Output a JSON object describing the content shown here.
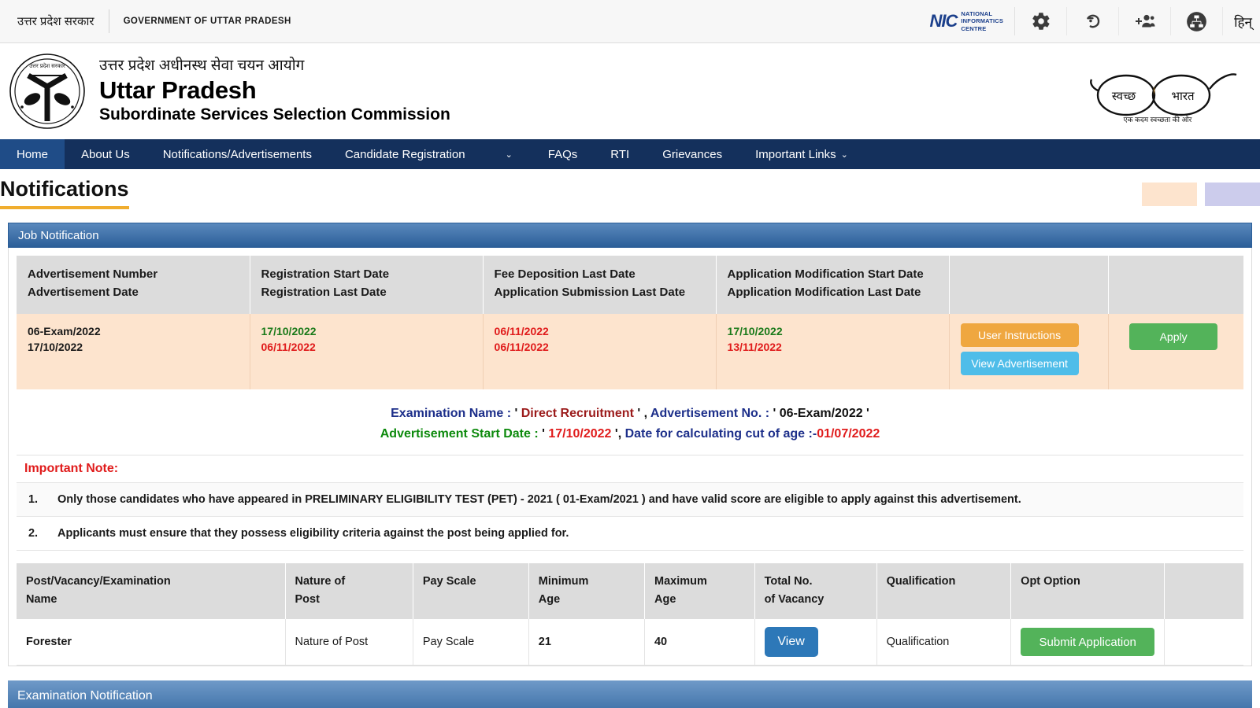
{
  "gov_strip": {
    "hindi": "उत्तर प्रदेश सरकार",
    "english": "GOVERNMENT OF UTTAR PRADESH",
    "nic_mark": "NIC",
    "nic_line1": "NATIONAL",
    "nic_line2": "INFORMATICS",
    "nic_line3": "CENTRE",
    "icons": [
      {
        "name": "gear-icon",
        "label": "Settings"
      },
      {
        "name": "undo-icon",
        "label": "Reset"
      },
      {
        "name": "add-user-icon",
        "label": "Add User"
      },
      {
        "name": "sitemap-icon",
        "label": "Site Map"
      }
    ],
    "language_toggle": "हिन्"
  },
  "masthead": {
    "org_hindi": "उत्तर प्रदेश अधीनस्थ सेवा चयन आयोग",
    "org_name": "Uttar Pradesh",
    "org_sub": "Subordinate Services Selection Commission",
    "swachh_hindi_left": "स्वच्छ",
    "swachh_hindi_right": "भारत",
    "swachh_tagline": "एक कदम स्वच्छता की ओर"
  },
  "nav": {
    "items": [
      {
        "label": "Home",
        "active": true,
        "caret": false
      },
      {
        "label": "About Us",
        "active": false,
        "caret": false
      },
      {
        "label": "Notifications/Advertisements",
        "active": false,
        "caret": false
      },
      {
        "label": "Candidate Registration",
        "active": false,
        "caret": false
      },
      {
        "label": "",
        "active": false,
        "caret": true
      },
      {
        "label": "FAQs",
        "active": false,
        "caret": false
      },
      {
        "label": "RTI",
        "active": false,
        "caret": false
      },
      {
        "label": "Grievances",
        "active": false,
        "caret": false
      },
      {
        "label": "Important Links",
        "active": false,
        "caret": true
      }
    ],
    "caret_glyph": "⌄"
  },
  "page": {
    "title": "Notifications",
    "title_underline_color": "#f0ad2e",
    "legend": [
      {
        "name": "legend-peach",
        "color": "#fde4ce"
      },
      {
        "name": "legend-lavender",
        "color": "#ccccec"
      }
    ]
  },
  "job_panel": {
    "heading": "Job Notification",
    "columns": [
      {
        "line1": "Advertisement Number",
        "line2": "Advertisement Date"
      },
      {
        "line1": "Registration Start Date",
        "line2": "Registration Last Date"
      },
      {
        "line1": "Fee Deposition Last Date",
        "line2": "Application Submission Last Date"
      },
      {
        "line1": "Application Modification Start Date",
        "line2": "Application Modification Last Date"
      },
      {
        "line1": "",
        "line2": ""
      },
      {
        "line1": "",
        "line2": ""
      }
    ],
    "row": {
      "advertisement_number": "06-Exam/2022",
      "advertisement_date": "17/10/2022",
      "registration_start_date": "17/10/2022",
      "registration_last_date": "06/11/2022",
      "fee_deposition_last_date": "06/11/2022",
      "application_submission_last_date": "06/11/2022",
      "application_modification_start_date": "17/10/2022",
      "application_modification_last_date": "13/11/2022",
      "btn_user_instructions": "User Instructions",
      "btn_view_advertisement": "View Advertisement",
      "btn_apply": "Apply"
    }
  },
  "exam_info": {
    "line1_label_a": "Examination Name : ",
    "line1_quote_open_a": "' ",
    "line1_value_a": "Direct Recruitment",
    "line1_quote_close_a": " ' ",
    "line1_sep": ", ",
    "line1_label_b": "Advertisement No. : ",
    "line1_quote_open_b": "' ",
    "line1_value_b": "06-Exam/2022",
    "line1_quote_close_b": " '",
    "line2_label_a": "Advertisement Start Date : ",
    "line2_quote_open": "' ",
    "line2_value_a": "17/10/2022",
    "line2_quote_close": " '",
    "line2_sep": ", ",
    "line2_label_b": "Date for calculating cut of age :-",
    "line2_value_b": "01/07/2022"
  },
  "important_note": {
    "title": "Important Note:",
    "items": [
      {
        "num": "1.",
        "text": "Only those candidates who have appeared in PRELIMINARY ELIGIBILITY TEST (PET) - 2021 ( 01-Exam/2021 ) and have valid score are eligible to apply against this advertisement."
      },
      {
        "num": "2.",
        "text": "Applicants must ensure that they possess eligibility criteria against the post being applied for."
      }
    ]
  },
  "post_table": {
    "columns": [
      {
        "line1": "Post/Vacancy/Examination",
        "line2": "Name"
      },
      {
        "line1": "Nature of",
        "line2": "Post"
      },
      {
        "line1": "Pay Scale",
        "line2": ""
      },
      {
        "line1": "Minimum",
        "line2": "Age"
      },
      {
        "line1": "Maximum",
        "line2": "Age"
      },
      {
        "line1": "Total No.",
        "line2": " of Vacancy"
      },
      {
        "line1": "Qualification",
        "line2": ""
      },
      {
        "line1": "Opt Option",
        "line2": ""
      },
      {
        "line1": "",
        "line2": ""
      }
    ],
    "rows": [
      {
        "post_name": "Forester",
        "nature_of_post": "Nature of Post",
        "pay_scale": "Pay Scale",
        "minimum_age": "21",
        "maximum_age": "40",
        "total_vacancy_btn": "View",
        "qualification": "Qualification",
        "opt_option_btn": "Submit Application"
      }
    ]
  },
  "bottom_panel": {
    "heading": "Examination Notification"
  }
}
